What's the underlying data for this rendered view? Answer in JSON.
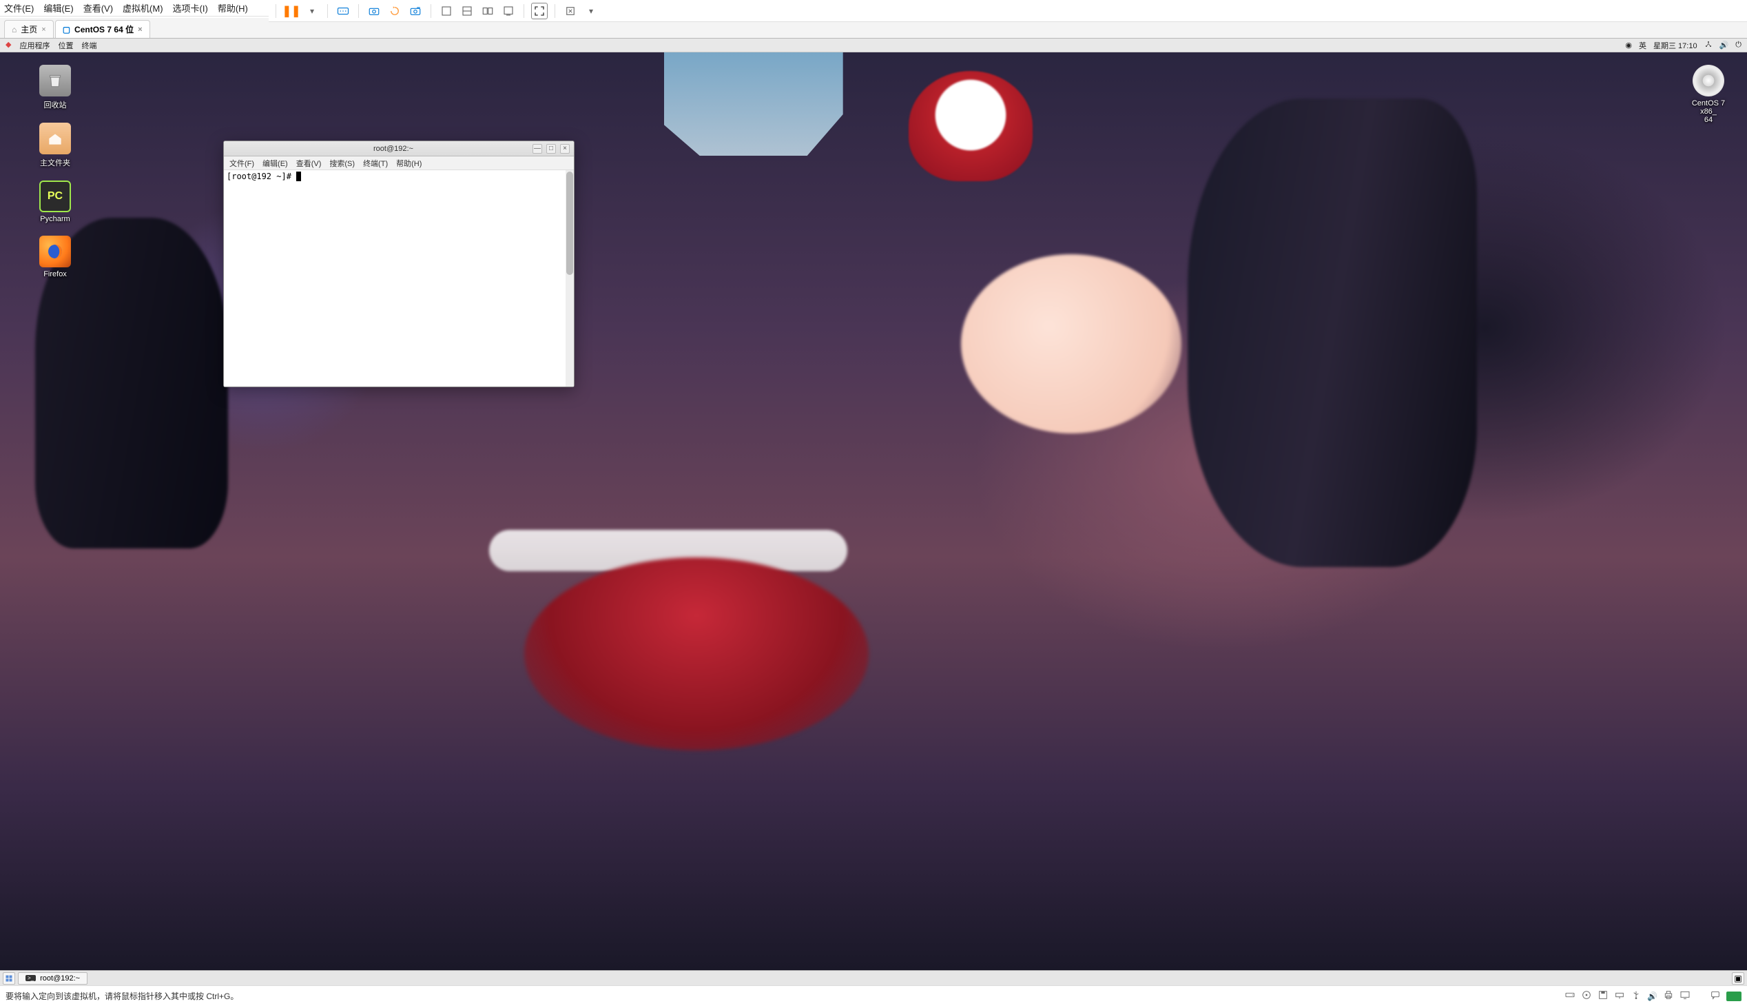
{
  "vmware": {
    "menu": {
      "file": "文件(E)",
      "edit": "编辑(E)",
      "view": "查看(V)",
      "vm": "虚拟机(M)",
      "tabs": "选项卡(I)",
      "help": "帮助(H)"
    },
    "tabs": {
      "home": "主页",
      "centos": "CentOS 7 64 位"
    },
    "status_hint": "要将输入定向到该虚拟机，请将鼠标指针移入其中或按 Ctrl+G。"
  },
  "gnome": {
    "top": {
      "apps": "应用程序",
      "places": "位置",
      "terminal": "终端",
      "ime": "英",
      "datetime": "星期三 17:10"
    },
    "desktop_icons": {
      "trash": "回收站",
      "home": "主文件夹",
      "pycharm": "Pycharm",
      "firefox": "Firefox",
      "disc": "CentOS 7 x86_\n64"
    },
    "taskbar": {
      "terminal": "root@192:~"
    }
  },
  "terminal": {
    "title": "root@192:~",
    "menu": {
      "file": "文件(F)",
      "edit": "编辑(E)",
      "view": "查看(V)",
      "search": "搜索(S)",
      "terminal": "终端(T)",
      "help": "帮助(H)"
    },
    "prompt": "[root@192 ~]# "
  },
  "icons": {
    "pause": "❚❚",
    "dropdown": "▾",
    "close": "×",
    "minimize": "—",
    "maximize": "□",
    "home": "⌂",
    "network": "⥉",
    "sound": "🔊",
    "power": "⏻",
    "accessibility": "◉",
    "terminal_glyph": ">_",
    "windows": "▣",
    "square": "▢"
  }
}
